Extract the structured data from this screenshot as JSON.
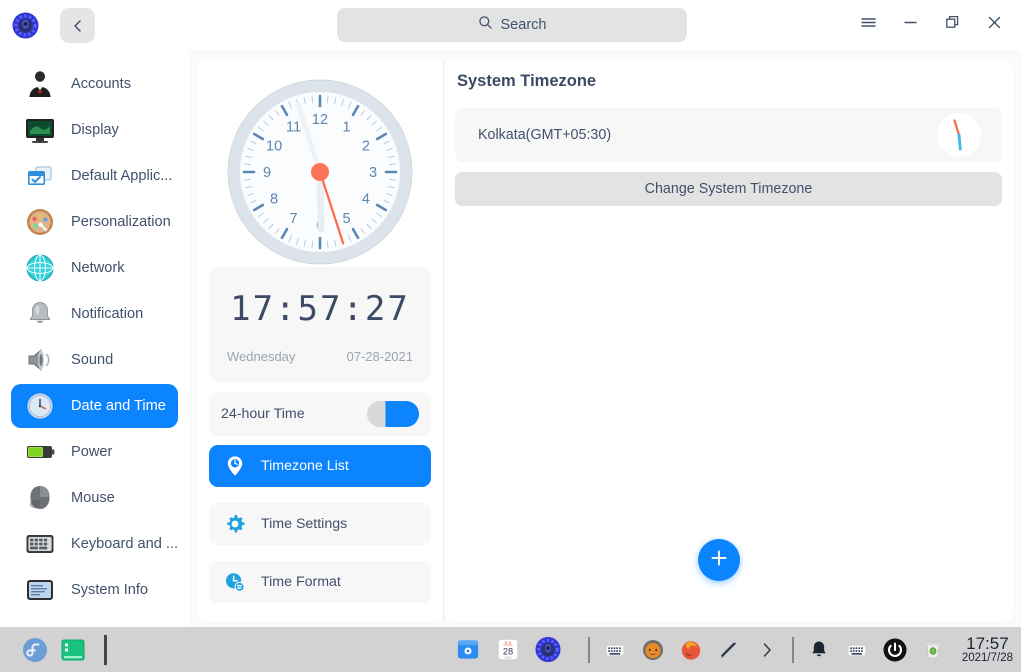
{
  "window": {
    "logo_icon": "deepin-logo-icon",
    "back_icon": "chevron-left-icon",
    "menu_icon": "hamburger-menu-icon",
    "minimize_icon": "minimize-icon",
    "maximize_icon": "maximize-restore-icon",
    "close_icon": "close-icon"
  },
  "search": {
    "label": "Search",
    "icon": "search-icon"
  },
  "sidebar": {
    "items": [
      {
        "label": "Accounts",
        "icon": "accounts-icon",
        "active": false
      },
      {
        "label": "Display",
        "icon": "display-icon",
        "active": false
      },
      {
        "label": "Default Applic...",
        "icon": "default-applications-icon",
        "active": false
      },
      {
        "label": "Personalization",
        "icon": "personalization-icon",
        "active": false
      },
      {
        "label": "Network",
        "icon": "network-icon",
        "active": false
      },
      {
        "label": "Notification",
        "icon": "notification-icon",
        "active": false
      },
      {
        "label": "Sound",
        "icon": "sound-icon",
        "active": false
      },
      {
        "label": "Date and Time",
        "icon": "date-and-time-icon",
        "active": true
      },
      {
        "label": "Power",
        "icon": "power-icon",
        "active": false
      },
      {
        "label": "Mouse",
        "icon": "mouse-icon",
        "active": false
      },
      {
        "label": "Keyboard and ...",
        "icon": "keyboard-icon",
        "active": false
      },
      {
        "label": "System Info",
        "icon": "system-info-icon",
        "active": false
      }
    ]
  },
  "clock_panel": {
    "analog": {
      "hour_numbers": [
        "12",
        "1",
        "2",
        "3",
        "4",
        "5",
        "6",
        "7",
        "8",
        "9",
        "10",
        "11"
      ],
      "hour_hand_deg": 179,
      "minute_hand_deg": 342,
      "second_hand_deg": 162
    },
    "digital_time": "17:57:27",
    "weekday": "Wednesday",
    "date": "07-28-2021",
    "toggle": {
      "label": "24-hour Time",
      "state": "on"
    },
    "nav": [
      {
        "label": "Timezone List",
        "icon": "map-pin-clock-icon",
        "active": true
      },
      {
        "label": "Time Settings",
        "icon": "gear-icon",
        "active": false
      },
      {
        "label": "Time Format",
        "icon": "clock-format-icon",
        "active": false
      }
    ]
  },
  "main": {
    "title": "System Timezone",
    "timezone_value": "Kolkata(GMT+05:30)",
    "timezone_mini_clock_icon": "mini-clock-icon",
    "change_button": "Change System Timezone",
    "add_button_icon": "plus-icon"
  },
  "taskbar": {
    "launchers": [
      {
        "icon": "fedora-icon"
      },
      {
        "icon": "terminal-icon"
      }
    ],
    "center": [
      {
        "icon": "store-icon"
      },
      {
        "icon": "calendar-icon",
        "month": "JUL",
        "day": "28"
      },
      {
        "icon": "control-center-icon"
      }
    ],
    "tray": [
      {
        "icon": "keyboard-layout-icon"
      },
      {
        "icon": "pumpkin-icon"
      },
      {
        "icon": "firefox-icon"
      },
      {
        "icon": "pen-icon"
      },
      {
        "icon": "tray-expand-chevron-icon"
      },
      {
        "icon": "notification-bell-icon"
      },
      {
        "icon": "onboard-keyboard-icon"
      },
      {
        "icon": "power-button-icon"
      },
      {
        "icon": "trash-icon"
      }
    ],
    "clock_time": "17:57",
    "clock_date": "2021/7/28"
  },
  "colors": {
    "accent": "#0c84fe",
    "text": "#41506b",
    "heading": "#3c4a66",
    "panel_bg": "#f7f7f8",
    "taskbar_bg": "#d2d2d2"
  }
}
